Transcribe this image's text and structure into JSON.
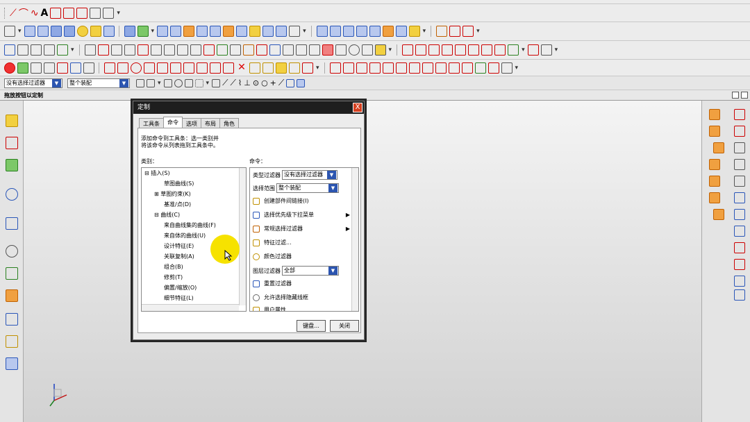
{
  "toolbar_filter": {
    "selection_filter": "没有选择过滤器",
    "scope": "整个装配"
  },
  "status": {
    "hint": "拖放按钮以定制"
  },
  "dialog": {
    "title": "定制",
    "close": "X",
    "tabs": [
      "工具条",
      "命令",
      "选项",
      "布局",
      "角色"
    ],
    "active_tab": 1,
    "description_lines": [
      "添加命令到工具条：选一类别并",
      "将该命令从列表拖到工具条中。"
    ],
    "categories_label": "类别：",
    "categories": [
      "⊟ 插入(S)",
      "草图曲线(S)",
      "⊞ 草图约束(K)",
      "基准/点(D)",
      "⊟ 曲线(C)",
      "来自曲线集的曲线(F)",
      "来自体的曲线(U)",
      "设计特征(E)",
      "关联复制(A)",
      "组合(B)",
      "修剪(T)",
      "偏置/缩放(O)",
      "细节特征(L)"
    ],
    "commands_label": "命令：",
    "type_filter_label": "类型过滤器",
    "type_filter_value": "没有选择过滤器",
    "scope_label": "选择范围",
    "scope_value": "整个装配",
    "commands": [
      "创建部件间链接(I)",
      "选择优先级下拉菜单",
      "常规选择过滤器",
      "特征过滤...",
      "颜色过滤器"
    ],
    "layer_filter_label": "图层过滤器",
    "layer_filter_value": "全部",
    "commands2": [
      "重置过滤器",
      "允许选择隐藏线框",
      "用户属性..."
    ],
    "ok_button": "键盘...",
    "close_button": "关闭"
  }
}
